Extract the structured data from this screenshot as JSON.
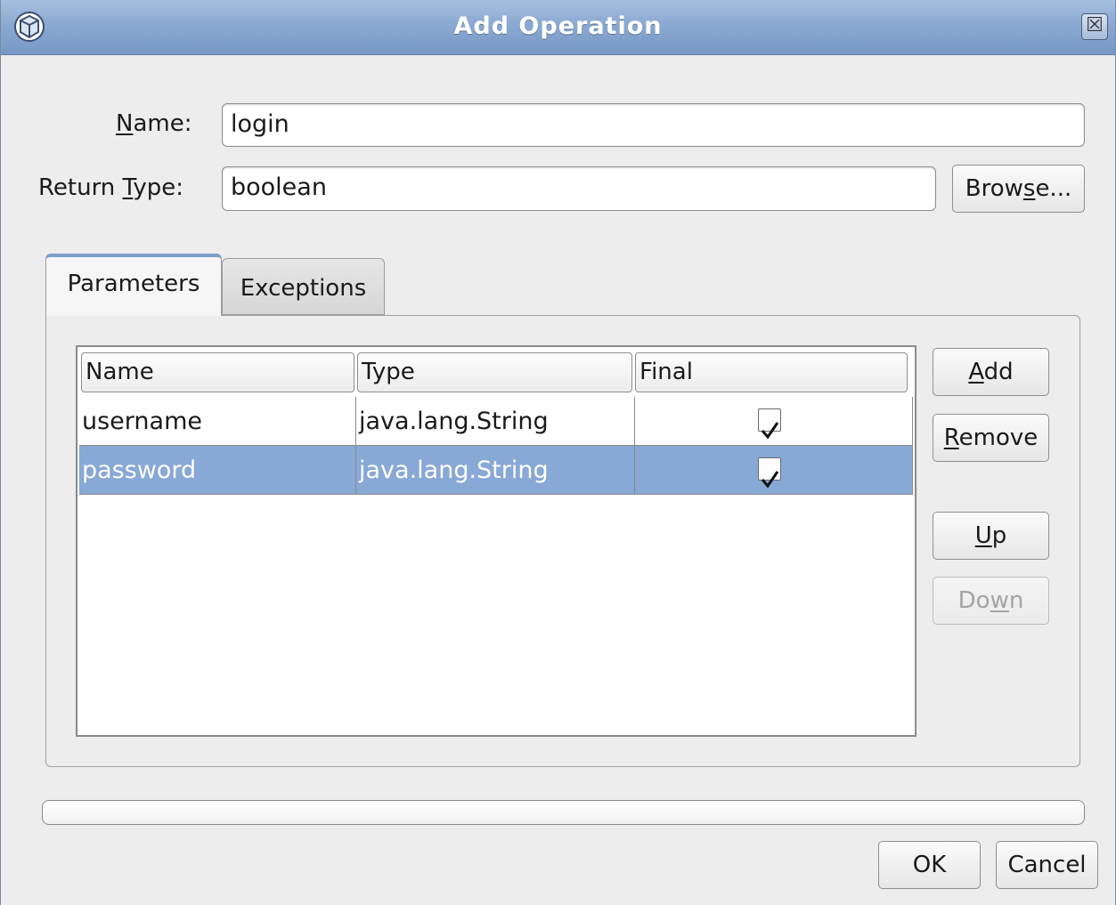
{
  "window": {
    "title": "Add Operation",
    "close_glyph": "☒"
  },
  "form": {
    "name_label_pre": "",
    "name_label_mnemonic": "N",
    "name_label_post": "ame:",
    "name_value": "login",
    "return_type_label_pre": "Return ",
    "return_type_label_mnemonic": "T",
    "return_type_label_post": "ype:",
    "return_type_value": "boolean",
    "browse_pre": "Brow",
    "browse_mnemonic": "s",
    "browse_post": "e..."
  },
  "tabs": [
    {
      "label": "Parameters",
      "active": true
    },
    {
      "label": "Exceptions",
      "active": false
    }
  ],
  "table": {
    "columns": [
      "Name",
      "Type",
      "Final"
    ],
    "rows": [
      {
        "name": "username",
        "type": "java.lang.String",
        "final": true,
        "selected": false
      },
      {
        "name": "password",
        "type": "java.lang.String",
        "final": true,
        "selected": true
      }
    ]
  },
  "side_buttons": {
    "add_mnemonic": "A",
    "add_post": "dd",
    "remove_mnemonic": "R",
    "remove_post": "emove",
    "up_mnemonic": "U",
    "up_post": "p",
    "down_pre": "Do",
    "down_mnemonic": "w",
    "down_post": "n"
  },
  "footer": {
    "ok_label": "OK",
    "cancel_label": "Cancel"
  },
  "colors": {
    "titlebar": "#7f9fcb",
    "selection": "#88a8d6",
    "tab_accent": "#7c9dc9"
  }
}
